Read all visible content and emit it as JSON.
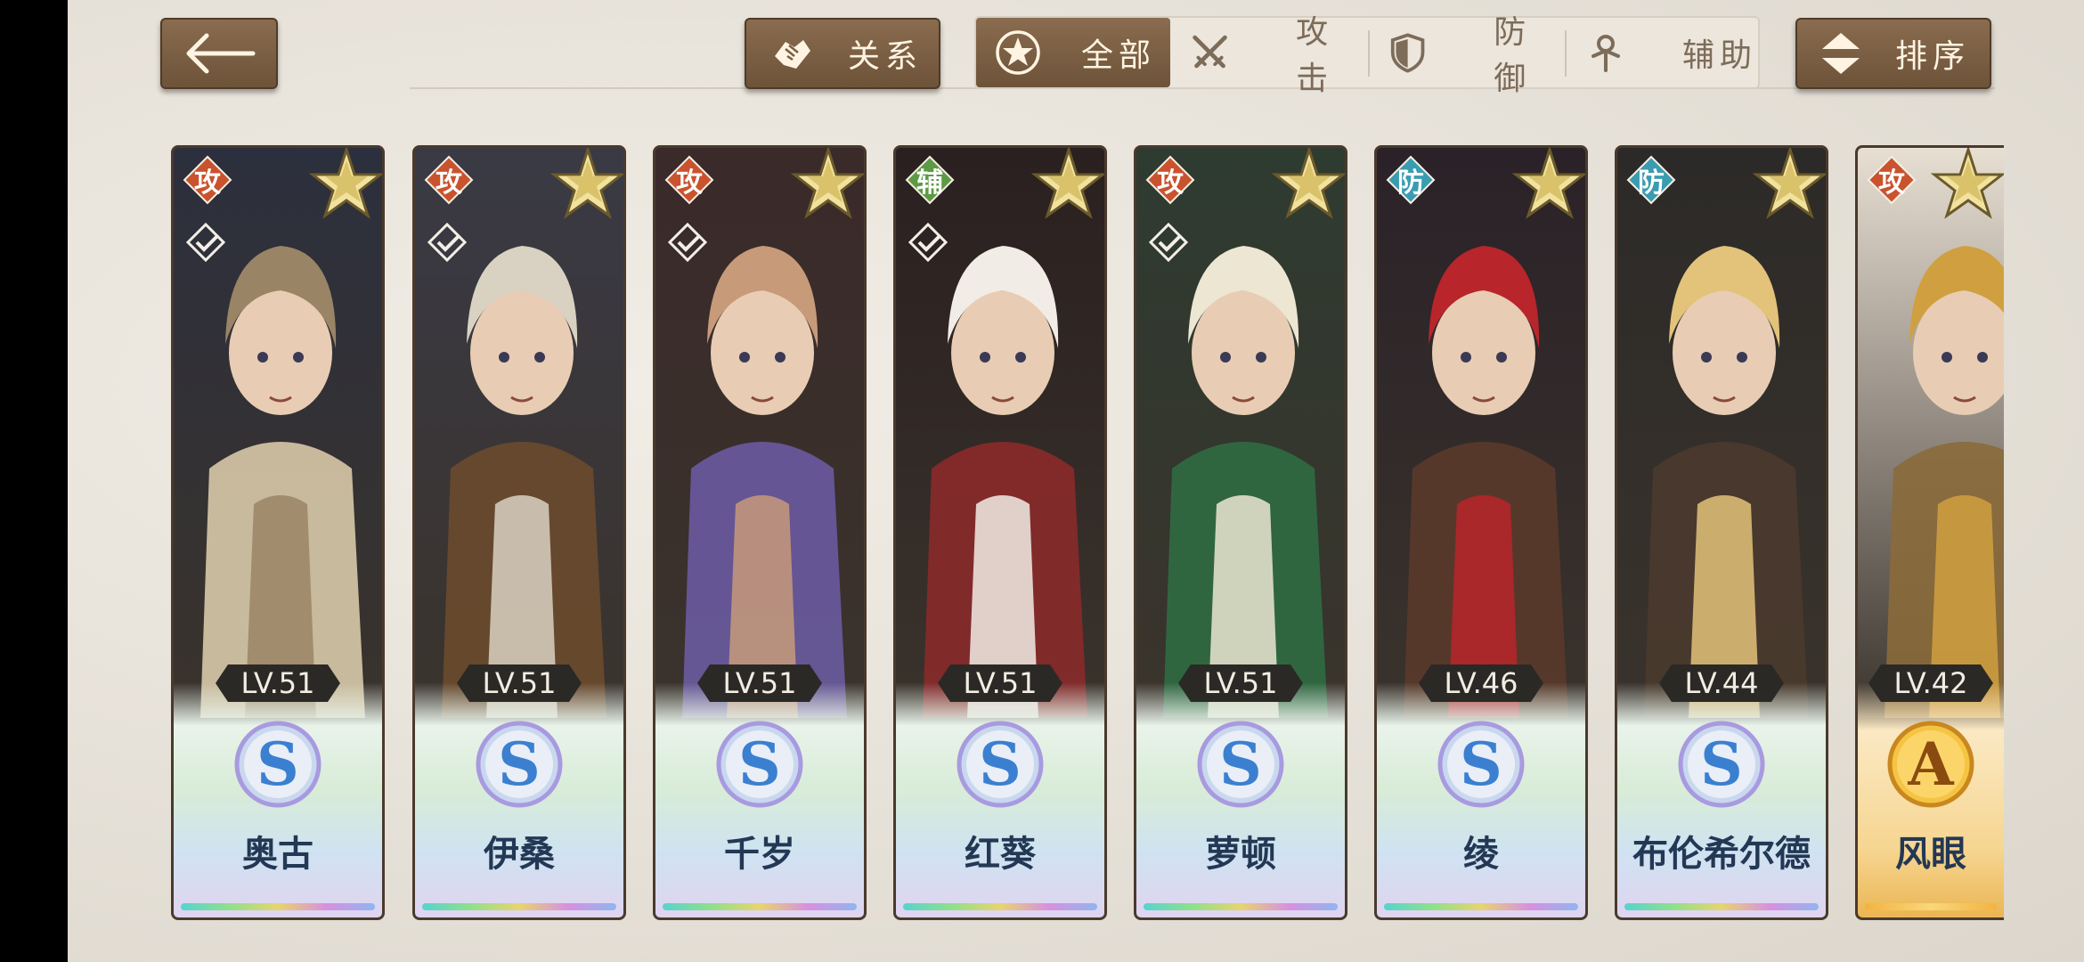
{
  "toolbar": {
    "back_label": "←",
    "relation_label": "关系",
    "sort_label": "排序"
  },
  "filter_tabs": [
    {
      "label": "全部",
      "icon": "star-circle-icon",
      "active": true
    },
    {
      "label": "攻击",
      "icon": "crossed-swords-icon",
      "active": false
    },
    {
      "label": "防御",
      "icon": "shield-icon",
      "active": false
    },
    {
      "label": "辅助",
      "icon": "ankh-icon",
      "active": false
    }
  ],
  "colors": {
    "attack": "#c9532e",
    "defense": "#3a9cb0",
    "support": "#5d9a45",
    "toolbar_brown": "#7b5f44",
    "name_text": "#233854"
  },
  "characters": [
    {
      "name": "奥古",
      "level": "LV.51",
      "role": "攻",
      "role_type": "attack",
      "grade": "S",
      "palette": [
        "#2c2f3d",
        "#9a8466",
        "#d8c9a8"
      ]
    },
    {
      "name": "伊桑",
      "level": "LV.51",
      "role": "攻",
      "role_type": "attack",
      "grade": "S",
      "palette": [
        "#3a3a45",
        "#d9d2c2",
        "#6b4a2e"
      ]
    },
    {
      "name": "千岁",
      "level": "LV.51",
      "role": "攻",
      "role_type": "attack",
      "grade": "S",
      "palette": [
        "#3a2a2a",
        "#c79a7a",
        "#6a5aa0"
      ]
    },
    {
      "name": "红葵",
      "level": "LV.51",
      "role": "辅",
      "role_type": "support",
      "grade": "S",
      "palette": [
        "#2a2020",
        "#f2ece6",
        "#8a2a2a"
      ]
    },
    {
      "name": "萝顿",
      "level": "LV.51",
      "role": "攻",
      "role_type": "attack",
      "grade": "S",
      "palette": [
        "#2e3b30",
        "#ece6d2",
        "#2f6b43"
      ]
    },
    {
      "name": "绫",
      "level": "LV.46",
      "role": "防",
      "role_type": "defense",
      "grade": "S",
      "palette": [
        "#2a2228",
        "#b8252a",
        "#5a3a2a"
      ]
    },
    {
      "name": "布伦希尔德",
      "level": "LV.44",
      "role": "防",
      "role_type": "defense",
      "grade": "S",
      "palette": [
        "#2c2a28",
        "#e3c27a",
        "#4a3a2e"
      ]
    },
    {
      "name": "风眼",
      "level": "LV.42",
      "role": "攻",
      "role_type": "attack",
      "grade": "A",
      "palette": [
        "#e8dfd3",
        "#d0a040",
        "#8a6a3a"
      ]
    }
  ]
}
